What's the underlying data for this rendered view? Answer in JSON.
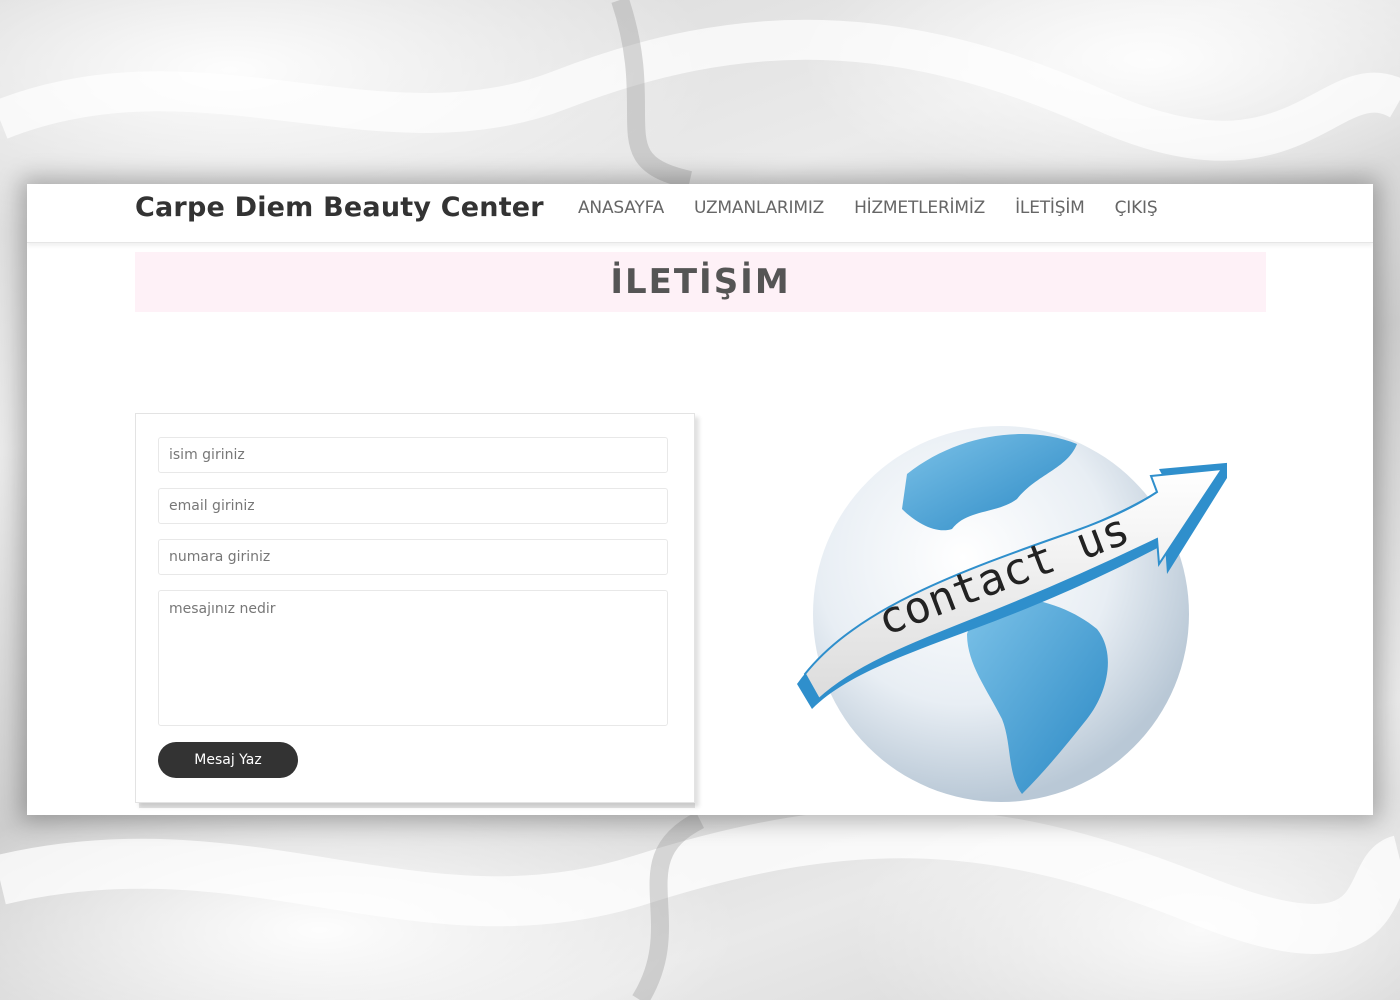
{
  "navbar": {
    "brand": "Carpe Diem Beauty Center",
    "links": [
      {
        "label": "ANASAYFA"
      },
      {
        "label": "UZMANLARIMIZ"
      },
      {
        "label": "HİZMETLERİMİZ"
      },
      {
        "label": "İLETİŞİM"
      },
      {
        "label": "ÇIKIŞ"
      }
    ]
  },
  "page": {
    "title": "İLETİŞİM"
  },
  "form": {
    "name_placeholder": "isim giriniz",
    "email_placeholder": "email giriniz",
    "phone_placeholder": "numara giriniz",
    "message_placeholder": "mesajınız nedir",
    "submit_label": "Mesaj Yaz"
  },
  "illustration": {
    "text": "contact us",
    "icon": "globe-arrow-icon",
    "colors": {
      "ocean": "#eaf2f8",
      "land": "#3d9fd3",
      "arrow": "#f6f6f6",
      "arrow_edge": "#2f8fcc"
    }
  }
}
